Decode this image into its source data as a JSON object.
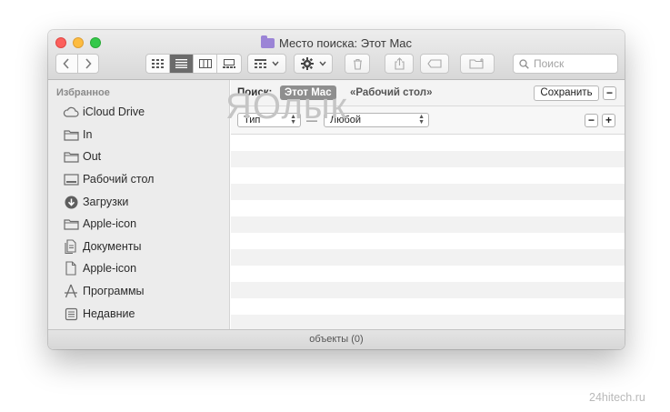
{
  "window": {
    "title": "Место поиска: Этот Mac"
  },
  "toolbar": {
    "search_placeholder": "Поиск",
    "nav": [
      "back-arrow-icon",
      "forward-arrow-icon"
    ],
    "view_modes": [
      "icon-view-icon",
      "list-view-icon",
      "column-view-icon",
      "gallery-view-icon"
    ],
    "active_view": "list-view-icon"
  },
  "sidebar": {
    "heading": "Избранное",
    "items": [
      {
        "label": "iCloud Drive",
        "icon": "cloud-icon"
      },
      {
        "label": "In",
        "icon": "folder-icon"
      },
      {
        "label": "Out",
        "icon": "folder-icon"
      },
      {
        "label": "Рабочий стол",
        "icon": "desktop-icon"
      },
      {
        "label": "Загрузки",
        "icon": "download-icon"
      },
      {
        "label": "Apple-icon",
        "icon": "folder-icon"
      },
      {
        "label": "Документы",
        "icon": "documents-icon"
      },
      {
        "label": "Apple-icon",
        "icon": "file-icon"
      },
      {
        "label": "Программы",
        "icon": "applications-icon"
      },
      {
        "label": "Недавние",
        "icon": "recents-icon"
      }
    ]
  },
  "search_scope": {
    "label": "Поиск:",
    "active": "Этот Mac",
    "other": "«Рабочий стол»",
    "save_label": "Сохранить",
    "remove_label": "−"
  },
  "criteria": {
    "attribute": "Тип",
    "separator": "—",
    "value": "Любой",
    "remove_label": "−",
    "add_label": "+"
  },
  "watermark": "ЯОлык",
  "status": {
    "text": "объекты (0)"
  },
  "credit": "24hitech.ru",
  "colors": {
    "close": "#fc605c",
    "minimize": "#fdbc40",
    "maximize": "#34c84a",
    "active_scope": "#8e8e8e",
    "sidebar_bg": "#ececec"
  }
}
